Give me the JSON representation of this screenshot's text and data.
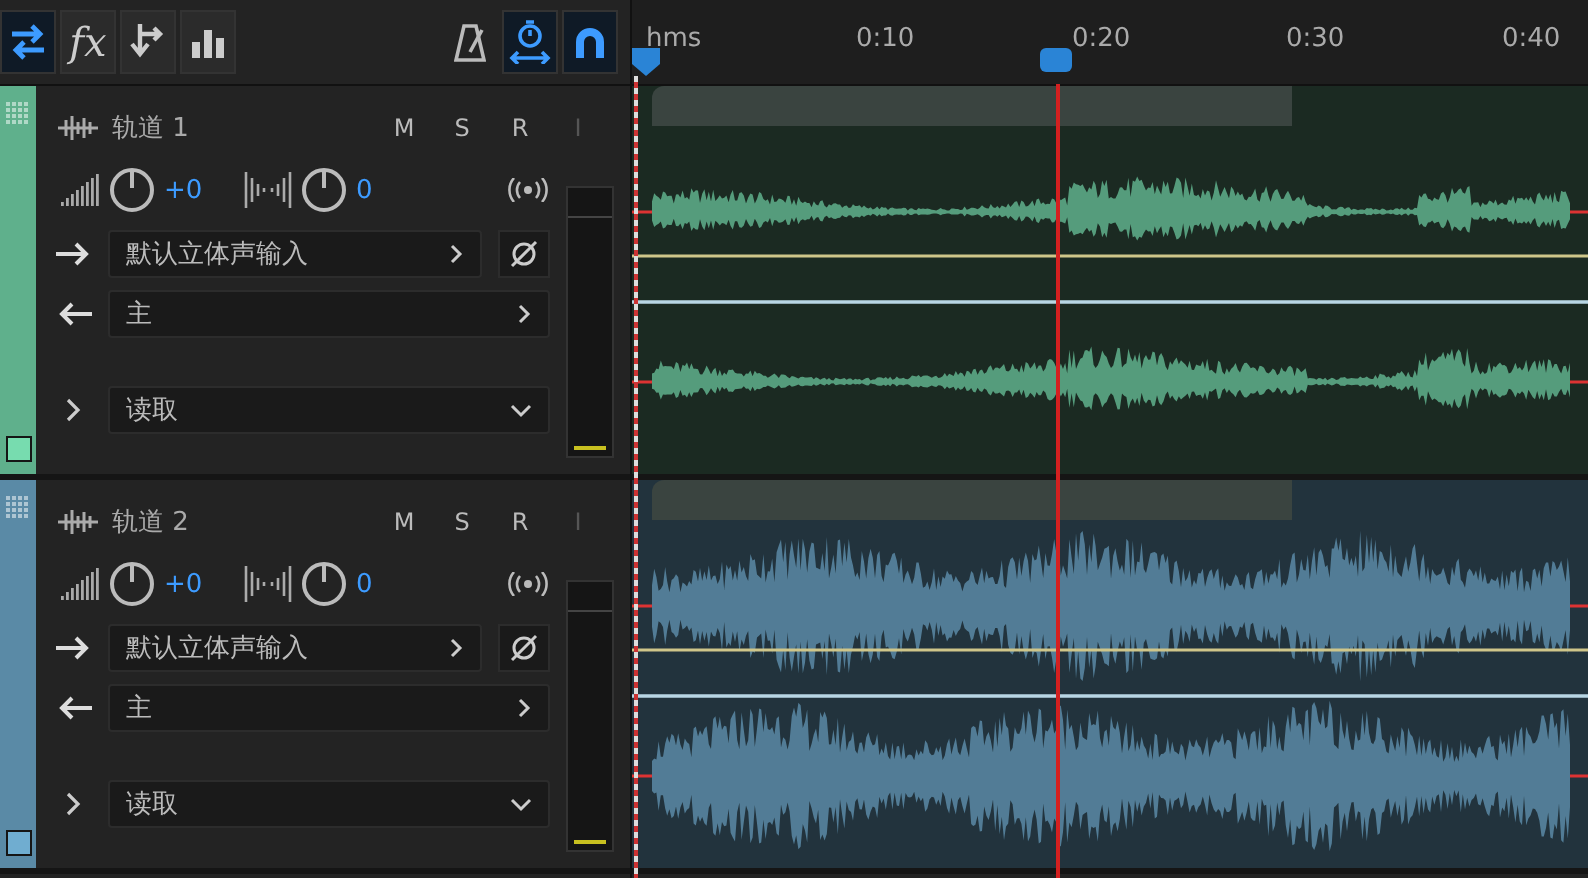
{
  "toolbar": {
    "left": [
      {
        "kind": "switch",
        "selected": true
      },
      {
        "kind": "fx",
        "label": "fx",
        "selected": false
      },
      {
        "kind": "sends",
        "selected": false
      },
      {
        "kind": "eq",
        "selected": false
      }
    ],
    "right": [
      {
        "kind": "metronome",
        "selected": false
      },
      {
        "kind": "stretch",
        "selected": true
      },
      {
        "kind": "snap",
        "selected": true
      }
    ]
  },
  "ruler": {
    "labels": [
      "hms",
      "0:10",
      "0:20",
      "0:30",
      "0:40"
    ]
  },
  "tracks": [
    {
      "name": "轨道 1",
      "color": "#5fb08c",
      "buttons": [
        "M",
        "S",
        "R",
        "I"
      ],
      "volume": "+0",
      "pan": "0",
      "input": "默认立体声输入",
      "output": "主",
      "automation": "读取"
    },
    {
      "name": "轨道 2",
      "color": "#5a8aa6",
      "buttons": [
        "M",
        "S",
        "R",
        "I"
      ],
      "volume": "+0",
      "pan": "0",
      "input": "默认立体声输入",
      "output": "主",
      "automation": "读取"
    }
  ]
}
